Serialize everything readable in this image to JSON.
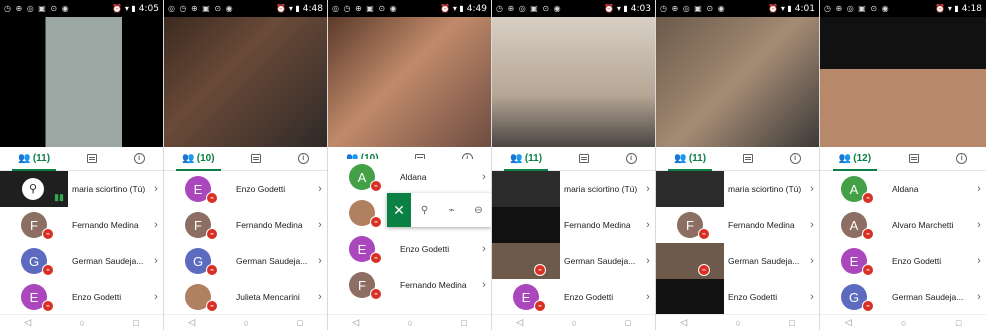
{
  "colors": {
    "accent": "#0b8043",
    "mute": "#d93025",
    "text": "#202124",
    "icon": "#5f6368"
  },
  "icons": {
    "people": "people-icon",
    "chat": "chat-icon",
    "info": "info-icon",
    "back": "back-nav-icon",
    "home": "home-nav-icon",
    "recents": "recents-nav-icon"
  },
  "nav": {
    "back": "◁",
    "home": "○",
    "recents": "□"
  },
  "phones": [
    {
      "status": {
        "left": "◷ ⊕ ◎ ▣ ⊙ ◉",
        "right": "⏰ ▾ ▮",
        "time": "4:05"
      },
      "tabs": {
        "people": "(11)"
      },
      "rows": [
        {
          "name": "maria sciortino (Tú)",
          "kind": "thumb",
          "initial": "",
          "color": "#1f1f1f",
          "muted": false
        },
        {
          "name": "Fernando Medina",
          "kind": "avatar",
          "initial": "F",
          "color": "#8d6e63",
          "muted": true
        },
        {
          "name": "German Saudeja...",
          "kind": "avatar",
          "initial": "G",
          "color": "#5c6bc0",
          "muted": true
        },
        {
          "name": "Enzo Godetti",
          "kind": "avatar",
          "initial": "E",
          "color": "#ab47bc",
          "muted": true
        }
      ]
    },
    {
      "status": {
        "left": "◎ ◷ ⊕ ▣ ⊙ ◉",
        "right": "⏰ ▾ ▮",
        "time": "4:48"
      },
      "tabs": {
        "people": "(10)"
      },
      "rows": [
        {
          "name": "Enzo Godetti",
          "kind": "avatar",
          "initial": "E",
          "color": "#ab47bc",
          "muted": true
        },
        {
          "name": "Fernando Medina",
          "kind": "avatar",
          "initial": "F",
          "color": "#8d6e63",
          "muted": true
        },
        {
          "name": "German Saudeja...",
          "kind": "avatar",
          "initial": "G",
          "color": "#5c6bc0",
          "muted": true
        },
        {
          "name": "Julieta Mencarini",
          "kind": "photo",
          "initial": "",
          "color": "#b08060",
          "muted": true
        }
      ]
    },
    {
      "status": {
        "left": "◎ ◷ ⊕ ▣ ⊙ ◉",
        "right": "⏰ ▾ ▮",
        "time": "4:49"
      },
      "tabs": {
        "people": "(10)"
      },
      "rows": [
        {
          "name": "Aldana",
          "kind": "avatar",
          "initial": "A",
          "color": "#43a047",
          "muted": true
        },
        {
          "name": "",
          "kind": "photo",
          "initial": "",
          "color": "#b08060",
          "muted": true
        },
        {
          "name": "Enzo Godetti",
          "kind": "avatar",
          "initial": "E",
          "color": "#ab47bc",
          "muted": true
        },
        {
          "name": "Fernando Medina",
          "kind": "avatar",
          "initial": "F",
          "color": "#8d6e63",
          "muted": true
        }
      ]
    },
    {
      "status": {
        "left": "◷ ⊕ ◎ ▣ ⊙ ◉",
        "right": "⏰ ▾ ▮",
        "time": "4:03"
      },
      "tabs": {
        "people": "(11)"
      },
      "rows": [
        {
          "name": "maria sciortino (Tú)",
          "kind": "thumb",
          "initial": "",
          "color": "#2b2b2b",
          "muted": false
        },
        {
          "name": "Fernando Medina",
          "kind": "thumb",
          "initial": "",
          "color": "#111111",
          "muted": false
        },
        {
          "name": "German Saudeja...",
          "kind": "thumb",
          "initial": "",
          "color": "#6d5a4a",
          "muted": true
        },
        {
          "name": "Enzo Godetti",
          "kind": "avatar",
          "initial": "E",
          "color": "#ab47bc",
          "muted": true
        }
      ]
    },
    {
      "status": {
        "left": "◷ ⊕ ◎ ▣ ⊙ ◉",
        "right": "⏰ ▾ ▮",
        "time": "4:01"
      },
      "tabs": {
        "people": "(11)"
      },
      "rows": [
        {
          "name": "maria sciortino (Tú)",
          "kind": "thumb",
          "initial": "",
          "color": "#2b2b2b",
          "muted": false
        },
        {
          "name": "Fernando Medina",
          "kind": "avatar",
          "initial": "F",
          "color": "#8d6e63",
          "muted": true
        },
        {
          "name": "German Saudeja...",
          "kind": "thumb",
          "initial": "",
          "color": "#6d5a4a",
          "muted": true
        },
        {
          "name": "Enzo Godetti",
          "kind": "thumb",
          "initial": "",
          "color": "#111111",
          "muted": false
        }
      ]
    },
    {
      "status": {
        "left": "◷ ⊕ ◎ ▣ ⊙ ◉",
        "right": "⏰ ▾ ▮",
        "time": "4:18"
      },
      "tabs": {
        "people": "(12)"
      },
      "rows": [
        {
          "name": "Aldana",
          "kind": "avatar",
          "initial": "A",
          "color": "#43a047",
          "muted": true
        },
        {
          "name": "Alvaro Marchetti",
          "kind": "avatar",
          "initial": "A",
          "color": "#8d6e63",
          "muted": true
        },
        {
          "name": "Enzo Godetti",
          "kind": "avatar",
          "initial": "E",
          "color": "#ab47bc",
          "muted": true
        },
        {
          "name": "German Saudeja...",
          "kind": "avatar",
          "initial": "G",
          "color": "#5c6bc0",
          "muted": true
        }
      ]
    }
  ],
  "actions_popup": {
    "close": "✕",
    "pin": "⚲",
    "mute": "⌁",
    "remove": "⊖"
  }
}
